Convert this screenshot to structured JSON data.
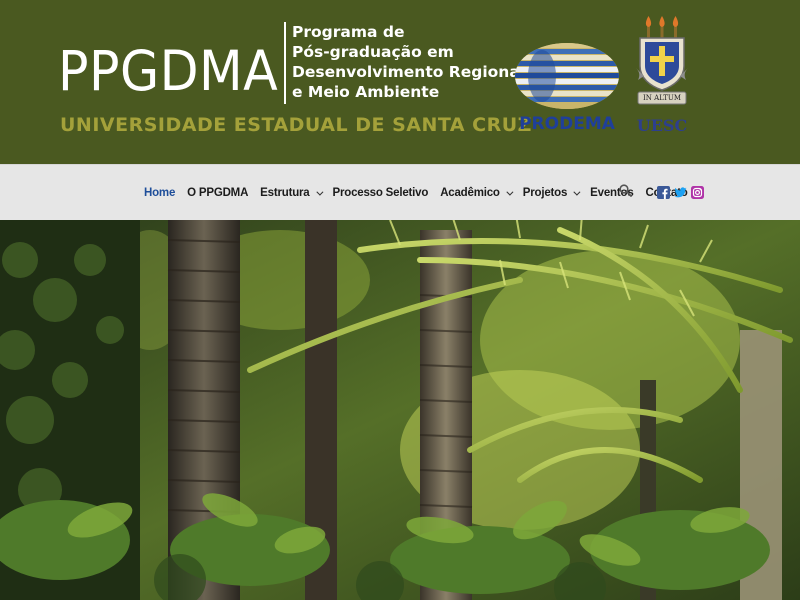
{
  "header": {
    "acronym": "PPGDMA",
    "program_lines": [
      "Programa de",
      "Pós-graduação em",
      "Desenvolvimento Regional",
      "e Meio Ambiente"
    ],
    "university": "UNIVERSIDADE ESTADUAL DE SANTA CRUZ",
    "prodema_logo_text": "PRODEMA",
    "uesc_logo_text": "UESC",
    "uesc_motto": "IN ALTUM"
  },
  "nav": {
    "items": [
      {
        "label": "Home",
        "active": true,
        "dropdown": false
      },
      {
        "label": "O PPGDMA",
        "active": false,
        "dropdown": false
      },
      {
        "label": "Estrutura",
        "active": false,
        "dropdown": true
      },
      {
        "label": "Processo Seletivo",
        "active": false,
        "dropdown": false
      },
      {
        "label": "Acadêmico",
        "active": false,
        "dropdown": true
      },
      {
        "label": "Projetos",
        "active": false,
        "dropdown": true
      },
      {
        "label": "Eventos",
        "active": false,
        "dropdown": false
      },
      {
        "label": "Contato",
        "active": false,
        "dropdown": false
      }
    ],
    "search_icon": "search-icon",
    "social_icons": [
      "facebook-icon",
      "twitter-icon",
      "instagram-icon"
    ]
  },
  "colors": {
    "banner_bg": "#4a5920",
    "university_text": "#a4a13a",
    "nav_bg": "#e6e6e6",
    "nav_active": "#1e4e9a",
    "facebook": "#3b5998",
    "twitter": "#1da1f2",
    "instagram": "#b034a8"
  },
  "hero": {
    "image": "tropical-forest-photo"
  }
}
